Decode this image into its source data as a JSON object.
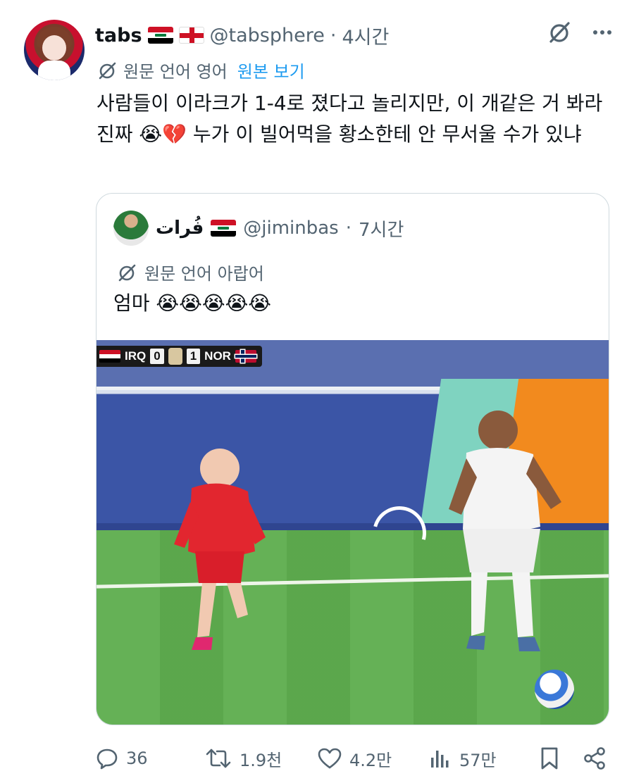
{
  "tweet": {
    "author_name": "tabs",
    "author_handle": "@tabsphere",
    "separator": "·",
    "time": "4시간",
    "translate_label": "원문 언어 영어",
    "translate_link": "원본 보기",
    "text": "사람들이 이라크가 1-4로 졌다고 놀리지만, 이 개같은 거 봐라 진짜 😭💔 누가 이 빌어먹을 황소한테 안 무서울 수가 있냐"
  },
  "quote": {
    "author_name": "فُرات",
    "author_handle": "@jiminbas",
    "separator": "·",
    "time": "7시간",
    "translate_label": "원문 언어 아랍어",
    "text": "엄마 😭😭😭😭😭"
  },
  "scoreboard": {
    "left_team": "IRQ",
    "left_score": "0",
    "right_score": "1",
    "right_team": "NOR"
  },
  "actions": {
    "replies": "36",
    "reposts": "1.9천",
    "likes": "4.2만",
    "views": "57만"
  },
  "icons": {
    "more": "more-icon",
    "grok": "grok-icon",
    "translate": "translate-icon",
    "reply": "reply-icon",
    "repost": "repost-icon",
    "like": "like-icon",
    "views": "views-icon",
    "bookmark": "bookmark-icon",
    "share": "share-icon"
  },
  "colors": {
    "link": "#1d9bf0",
    "secondary_text": "#536471",
    "border": "#cfd9de"
  }
}
